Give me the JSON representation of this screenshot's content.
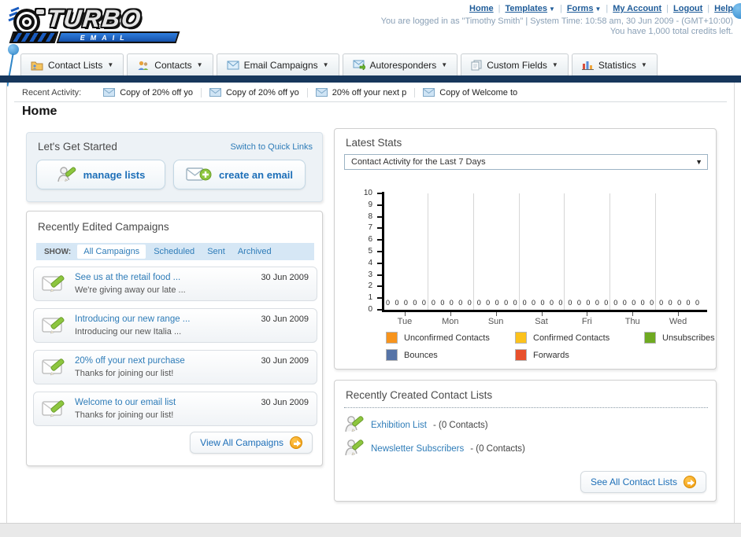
{
  "colors": {
    "accent_blue": "#1f5c99",
    "navy_bar": "#17375c",
    "link_blue": "#2e7cb8",
    "orange": "#f09a0e"
  },
  "header": {
    "logo_line1": "TURBO",
    "logo_line2": "EMAIL",
    "nav": [
      {
        "label": "Home",
        "caret": false
      },
      {
        "label": "Templates",
        "caret": true
      },
      {
        "label": "Forms",
        "caret": true
      },
      {
        "label": "My Account",
        "caret": false
      },
      {
        "label": "Logout",
        "caret": false
      },
      {
        "label": "Help",
        "caret": false
      }
    ],
    "login_info": "You are logged in as \"Timothy Smith\" | System Time: 10:58 am, 30 Jun 2009 - (GMT+10:00)",
    "credits_info": "You have 1,000 total credits left."
  },
  "tabs": [
    {
      "label": "Contact Lists"
    },
    {
      "label": "Contacts"
    },
    {
      "label": "Email Campaigns"
    },
    {
      "label": "Autoresponders"
    },
    {
      "label": "Custom Fields"
    },
    {
      "label": "Statistics"
    }
  ],
  "recent_activity": {
    "label": "Recent Activity:",
    "items": [
      "Copy of 20% off yo",
      "Copy of 20% off yo",
      "20% off your next p",
      "Copy of Welcome to"
    ]
  },
  "page_title": "Home",
  "get_started": {
    "title": "Let's Get Started",
    "switch_link": "Switch to Quick Links",
    "manage_lists_label": "manage lists",
    "create_email_label": "create an email"
  },
  "campaigns": {
    "title": "Recently Edited Campaigns",
    "show_label": "SHOW:",
    "filters": [
      "All Campaigns",
      "Scheduled",
      "Sent",
      "Archived"
    ],
    "active_filter": "All Campaigns",
    "items": [
      {
        "title": "See us at the retail food ...",
        "subtitle": "We're giving away our late ...",
        "date": "30 Jun 2009"
      },
      {
        "title": "Introducing our new range ...",
        "subtitle": "Introducing our new Italia ...",
        "date": "30 Jun 2009"
      },
      {
        "title": "20% off your next purchase",
        "subtitle": "Thanks for joining our list!",
        "date": "30 Jun 2009"
      },
      {
        "title": "Welcome to our email list",
        "subtitle": "Thanks for joining our list!",
        "date": "30 Jun 2009"
      }
    ],
    "view_all_label": "View All Campaigns"
  },
  "stats": {
    "title": "Latest Stats",
    "dropdown_value": "Contact Activity for the Last 7 Days"
  },
  "chart_data": {
    "type": "bar",
    "title": "Contact Activity for the Last 7 Days",
    "categories": [
      "Tue",
      "Mon",
      "Sun",
      "Sat",
      "Fri",
      "Thu",
      "Wed"
    ],
    "series": [
      {
        "name": "Unconfirmed Contacts",
        "color": "#f7941d",
        "values": [
          0,
          0,
          0,
          0,
          0,
          0,
          0
        ]
      },
      {
        "name": "Confirmed Contacts",
        "color": "#fcc21c",
        "values": [
          0,
          0,
          0,
          0,
          0,
          0,
          0
        ]
      },
      {
        "name": "Unsubscribes",
        "color": "#6faa21",
        "values": [
          0,
          0,
          0,
          0,
          0,
          0,
          0
        ]
      },
      {
        "name": "Bounces",
        "color": "#5674a7",
        "values": [
          0,
          0,
          0,
          0,
          0,
          0,
          0
        ]
      },
      {
        "name": "Forwards",
        "color": "#e8502c",
        "values": [
          0,
          0,
          0,
          0,
          0,
          0,
          0
        ]
      }
    ],
    "xlabel": "",
    "ylabel": "",
    "ylim": [
      0,
      10
    ],
    "yticks": [
      0,
      1,
      2,
      3,
      4,
      5,
      6,
      7,
      8,
      9,
      10
    ],
    "grid": "vertical-between-groups",
    "legend_position": "bottom"
  },
  "contact_lists": {
    "title": "Recently Created Contact Lists",
    "items": [
      {
        "name": "Exhibition List",
        "detail": "- (0 Contacts)"
      },
      {
        "name": "Newsletter Subscribers",
        "detail": "- (0 Contacts)"
      }
    ],
    "see_all_label": "See All Contact Lists"
  }
}
